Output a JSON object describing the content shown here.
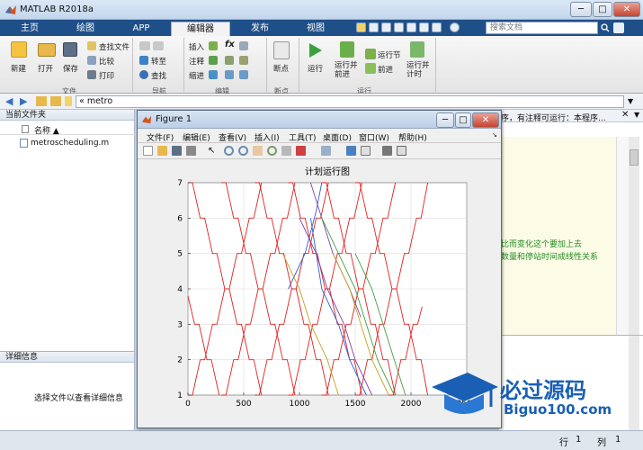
{
  "window": {
    "title": "MATLAB R2018a",
    "buttons": [
      "─",
      "□",
      "✕"
    ]
  },
  "tabs": [
    {
      "label": "主页",
      "active": false
    },
    {
      "label": "绘图",
      "active": false
    },
    {
      "label": "APP",
      "active": false
    },
    {
      "label": "编辑器",
      "active": true
    },
    {
      "label": "发布",
      "active": false
    },
    {
      "label": "视图",
      "active": false
    }
  ],
  "search": {
    "placeholder": "搜索文档"
  },
  "ribbon": {
    "file": {
      "section": "文件",
      "new": "新建",
      "open": "打开",
      "save": "保存",
      "find_files": "查找文件",
      "compare": "比较",
      "print": "打印"
    },
    "navigate": {
      "section": "导航",
      "goto": "转至",
      "find": "查找"
    },
    "edit": {
      "section": "编辑",
      "insert": "插入",
      "comment": "注释",
      "indent": "缩进",
      "fx": "fx"
    },
    "breakpoints": {
      "section": "断点",
      "breakpoint": "断点"
    },
    "run": {
      "section": "运行",
      "run": "运行",
      "run_advance": "运行并\n前进",
      "run_section": "运行节",
      "advance": "前进",
      "run_time": "运行并\n计时"
    }
  },
  "address": {
    "path": "« metro"
  },
  "current_folder": {
    "title": "当前文件夹",
    "name_header": "名称 ▲",
    "files": [
      "metroscheduling.m"
    ]
  },
  "details": {
    "title": "详细信息",
    "message": "选择文件以查看详细信息"
  },
  "editor": {
    "header_text": "序，有注释可运行：本程序...",
    "line1": "比而变化这个要加上去",
    "line2": "数量和停站时间成线性关系"
  },
  "figure": {
    "title": "Figure 1",
    "menu": [
      "文件(F)",
      "编辑(E)",
      "查看(V)",
      "插入(I)",
      "工具(T)",
      "桌面(D)",
      "窗口(W)",
      "帮助(H)"
    ],
    "controls": [
      "─",
      "□",
      "✕"
    ]
  },
  "status": {
    "row_label": "行",
    "row": "1",
    "col_label": "列",
    "col": "1"
  },
  "watermark": {
    "name": "必过源码",
    "url": "Biguo100.com"
  },
  "chart_data": {
    "type": "line",
    "title": "计划运行图",
    "xlim": [
      0,
      2500
    ],
    "ylim": [
      1,
      7
    ],
    "xticks": [
      0,
      500,
      1000,
      1500,
      2000,
      2500
    ],
    "yticks": [
      1,
      2,
      3,
      4,
      5,
      6,
      7
    ],
    "xtick_labels": [
      "0",
      "500",
      "1000",
      "1500",
      "2000",
      "2500"
    ],
    "ytick_labels": [
      "1",
      "2",
      "3",
      "4",
      "5",
      "6",
      "7"
    ],
    "grid": true,
    "series": [
      {
        "color": "#e02020",
        "points": [
          [
            0,
            7
          ],
          [
            40,
            7
          ],
          [
            110,
            6
          ],
          [
            150,
            6
          ],
          [
            220,
            5
          ],
          [
            260,
            5
          ],
          [
            330,
            4
          ],
          [
            370,
            4
          ],
          [
            440,
            3
          ],
          [
            480,
            3
          ],
          [
            550,
            2
          ],
          [
            590,
            2
          ],
          [
            660,
            1
          ]
        ]
      },
      {
        "color": "#e02020",
        "points": [
          [
            0,
            3.8
          ],
          [
            60,
            3
          ],
          [
            100,
            3
          ],
          [
            170,
            2
          ],
          [
            210,
            2
          ],
          [
            280,
            1
          ]
        ]
      },
      {
        "color": "#e02020",
        "points": [
          [
            0,
            1
          ],
          [
            40,
            1
          ],
          [
            110,
            2
          ],
          [
            150,
            2
          ],
          [
            220,
            3
          ],
          [
            260,
            3
          ],
          [
            330,
            4
          ],
          [
            370,
            4
          ],
          [
            440,
            5
          ],
          [
            480,
            5
          ],
          [
            550,
            6
          ],
          [
            590,
            6
          ],
          [
            660,
            7
          ]
        ]
      },
      {
        "color": "#e02020",
        "points": [
          [
            300,
            7
          ],
          [
            340,
            7
          ],
          [
            410,
            6
          ],
          [
            450,
            6
          ],
          [
            520,
            5
          ],
          [
            560,
            5
          ],
          [
            630,
            4
          ],
          [
            670,
            4
          ],
          [
            740,
            3
          ],
          [
            780,
            3
          ],
          [
            850,
            2
          ],
          [
            890,
            2
          ],
          [
            960,
            1
          ]
        ]
      },
      {
        "color": "#e02020",
        "points": [
          [
            300,
            1
          ],
          [
            340,
            1
          ],
          [
            410,
            2
          ],
          [
            450,
            2
          ],
          [
            520,
            3
          ],
          [
            560,
            3
          ],
          [
            630,
            4
          ],
          [
            670,
            4
          ],
          [
            740,
            5
          ],
          [
            780,
            5
          ],
          [
            850,
            6
          ],
          [
            890,
            6
          ],
          [
            960,
            7
          ]
        ]
      },
      {
        "color": "#e02020",
        "points": [
          [
            600,
            7
          ],
          [
            640,
            7
          ],
          [
            710,
            6
          ],
          [
            750,
            6
          ],
          [
            820,
            5
          ],
          [
            860,
            5
          ],
          [
            930,
            4
          ],
          [
            970,
            4
          ],
          [
            1040,
            3
          ],
          [
            1080,
            3
          ],
          [
            1150,
            2
          ],
          [
            1190,
            2
          ],
          [
            1260,
            1
          ]
        ]
      },
      {
        "color": "#e02020",
        "points": [
          [
            600,
            1
          ],
          [
            640,
            1
          ],
          [
            710,
            2
          ],
          [
            750,
            2
          ],
          [
            820,
            3
          ],
          [
            860,
            3
          ],
          [
            930,
            4
          ],
          [
            970,
            4
          ],
          [
            1040,
            5
          ],
          [
            1080,
            5
          ],
          [
            1150,
            6
          ],
          [
            1190,
            6
          ],
          [
            1260,
            7
          ]
        ]
      },
      {
        "color": "#e02020",
        "points": [
          [
            900,
            7
          ],
          [
            940,
            7
          ],
          [
            1010,
            6
          ],
          [
            1050,
            6
          ],
          [
            1120,
            5
          ],
          [
            1160,
            5
          ],
          [
            1230,
            4
          ],
          [
            1270,
            4
          ],
          [
            1340,
            3
          ],
          [
            1380,
            3
          ],
          [
            1450,
            2
          ],
          [
            1490,
            2
          ],
          [
            1560,
            1
          ]
        ]
      },
      {
        "color": "#e02020",
        "points": [
          [
            900,
            1
          ],
          [
            940,
            1
          ],
          [
            1010,
            2
          ],
          [
            1050,
            2
          ],
          [
            1120,
            3
          ],
          [
            1160,
            3
          ],
          [
            1230,
            4
          ],
          [
            1270,
            4
          ],
          [
            1340,
            5
          ],
          [
            1380,
            5
          ],
          [
            1450,
            6
          ],
          [
            1490,
            6
          ],
          [
            1560,
            7
          ]
        ]
      },
      {
        "color": "#e02020",
        "points": [
          [
            1200,
            7
          ],
          [
            1240,
            7
          ],
          [
            1310,
            6
          ],
          [
            1350,
            6
          ],
          [
            1420,
            5
          ],
          [
            1460,
            5
          ],
          [
            1530,
            4
          ],
          [
            1570,
            4
          ],
          [
            1640,
            3
          ],
          [
            1680,
            3
          ],
          [
            1750,
            2
          ],
          [
            1790,
            2
          ],
          [
            1860,
            1
          ]
        ]
      },
      {
        "color": "#e02020",
        "points": [
          [
            1200,
            1
          ],
          [
            1240,
            1
          ],
          [
            1310,
            2
          ],
          [
            1350,
            2
          ],
          [
            1420,
            3
          ],
          [
            1460,
            3
          ],
          [
            1530,
            4
          ],
          [
            1570,
            4
          ],
          [
            1640,
            5
          ],
          [
            1680,
            5
          ],
          [
            1750,
            6
          ],
          [
            1790,
            6
          ],
          [
            1860,
            7
          ]
        ]
      },
      {
        "color": "#e02020",
        "points": [
          [
            1500,
            7
          ],
          [
            1540,
            7
          ],
          [
            1610,
            6
          ],
          [
            1650,
            6
          ],
          [
            1720,
            5
          ],
          [
            1760,
            5
          ],
          [
            1830,
            4
          ],
          [
            1870,
            4
          ],
          [
            1940,
            3
          ],
          [
            1980,
            3
          ],
          [
            2050,
            2
          ],
          [
            2090,
            2
          ],
          [
            2150,
            1
          ]
        ]
      },
      {
        "color": "#e02020",
        "points": [
          [
            1500,
            1
          ],
          [
            1540,
            1
          ],
          [
            1610,
            2
          ],
          [
            1650,
            2
          ],
          [
            1720,
            3
          ],
          [
            1760,
            3
          ],
          [
            1830,
            4
          ],
          [
            1870,
            4
          ],
          [
            1940,
            5
          ],
          [
            1980,
            5
          ],
          [
            2050,
            6
          ],
          [
            2090,
            6
          ],
          [
            2150,
            7
          ]
        ]
      },
      {
        "color": "#e02020",
        "points": [
          [
            1800,
            1
          ],
          [
            1840,
            1
          ],
          [
            1910,
            2
          ],
          [
            1950,
            2
          ],
          [
            2020,
            3
          ],
          [
            2060,
            3
          ],
          [
            2100,
            3.5
          ]
        ]
      },
      {
        "color": "#3060d0",
        "points": [
          [
            900,
            4
          ],
          [
            1050,
            5
          ],
          [
            1150,
            6.2
          ],
          [
            1200,
            7
          ]
        ]
      },
      {
        "color": "#3060d0",
        "points": [
          [
            1100,
            6
          ],
          [
            1200,
            4
          ],
          [
            1350,
            3
          ],
          [
            1450,
            2
          ],
          [
            1600,
            1
          ]
        ]
      },
      {
        "color": "#8040a0",
        "points": [
          [
            1000,
            6
          ],
          [
            1150,
            5
          ],
          [
            1250,
            4
          ],
          [
            1400,
            3
          ],
          [
            1500,
            2
          ],
          [
            1650,
            1
          ]
        ]
      },
      {
        "color": "#8040a0",
        "points": [
          [
            1100,
            7
          ],
          [
            1300,
            5
          ],
          [
            1450,
            4
          ],
          [
            1550,
            3.2
          ]
        ]
      },
      {
        "color": "#c8a020",
        "points": [
          [
            850,
            5
          ],
          [
            1000,
            4
          ],
          [
            1100,
            3
          ],
          [
            1250,
            2
          ],
          [
            1350,
            1
          ]
        ]
      },
      {
        "color": "#c8a020",
        "points": [
          [
            1300,
            5
          ],
          [
            1450,
            4
          ],
          [
            1550,
            3
          ],
          [
            1650,
            2
          ],
          [
            1800,
            1
          ]
        ]
      },
      {
        "color": "#40a040",
        "points": [
          [
            1200,
            6
          ],
          [
            1350,
            5
          ],
          [
            1500,
            4
          ],
          [
            1600,
            3
          ],
          [
            1700,
            2
          ],
          [
            1850,
            1
          ]
        ]
      },
      {
        "color": "#40a040",
        "points": [
          [
            1500,
            5
          ],
          [
            1650,
            4
          ],
          [
            1750,
            3
          ],
          [
            1850,
            2
          ],
          [
            1950,
            1
          ]
        ]
      }
    ]
  }
}
